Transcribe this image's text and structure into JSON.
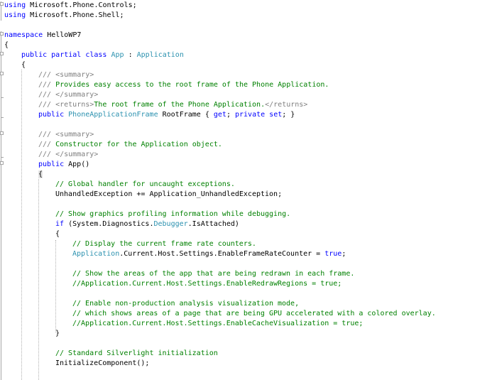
{
  "editor": {
    "lines": [
      {
        "indent": 0,
        "tokens": [
          {
            "c": "kw",
            "t": "using"
          },
          {
            "c": "",
            "t": " Microsoft.Phone.Controls;"
          }
        ]
      },
      {
        "indent": 0,
        "tokens": [
          {
            "c": "kw",
            "t": "using"
          },
          {
            "c": "",
            "t": " Microsoft.Phone.Shell;"
          }
        ]
      },
      {
        "indent": 0,
        "tokens": []
      },
      {
        "indent": 0,
        "tokens": [
          {
            "c": "kw",
            "t": "namespace"
          },
          {
            "c": "",
            "t": " HelloWP7"
          }
        ]
      },
      {
        "indent": 0,
        "tokens": [
          {
            "c": "",
            "t": "{"
          }
        ]
      },
      {
        "indent": 4,
        "tokens": [
          {
            "c": "kw",
            "t": "public"
          },
          {
            "c": "",
            "t": " "
          },
          {
            "c": "kw",
            "t": "partial"
          },
          {
            "c": "",
            "t": " "
          },
          {
            "c": "kw",
            "t": "class"
          },
          {
            "c": "",
            "t": " "
          },
          {
            "c": "ty",
            "t": "App"
          },
          {
            "c": "",
            "t": " : "
          },
          {
            "c": "ty",
            "t": "Application"
          }
        ]
      },
      {
        "indent": 4,
        "tokens": [
          {
            "c": "",
            "t": "{"
          }
        ]
      },
      {
        "indent": 8,
        "tokens": [
          {
            "c": "xd",
            "t": "///"
          },
          {
            "c": "cm",
            "t": " "
          },
          {
            "c": "xd",
            "t": "<summary>"
          }
        ]
      },
      {
        "indent": 8,
        "tokens": [
          {
            "c": "xd",
            "t": "///"
          },
          {
            "c": "cm",
            "t": " Provides easy access to the root frame of the Phone Application."
          }
        ]
      },
      {
        "indent": 8,
        "tokens": [
          {
            "c": "xd",
            "t": "///"
          },
          {
            "c": "cm",
            "t": " "
          },
          {
            "c": "xd",
            "t": "</summary>"
          }
        ]
      },
      {
        "indent": 8,
        "tokens": [
          {
            "c": "xd",
            "t": "///"
          },
          {
            "c": "cm",
            "t": " "
          },
          {
            "c": "xd",
            "t": "<returns>"
          },
          {
            "c": "cm",
            "t": "The root frame of the Phone Application."
          },
          {
            "c": "xd",
            "t": "</returns>"
          }
        ]
      },
      {
        "indent": 8,
        "tokens": [
          {
            "c": "kw",
            "t": "public"
          },
          {
            "c": "",
            "t": " "
          },
          {
            "c": "ty",
            "t": "PhoneApplicationFrame"
          },
          {
            "c": "",
            "t": " RootFrame { "
          },
          {
            "c": "kw",
            "t": "get"
          },
          {
            "c": "",
            "t": "; "
          },
          {
            "c": "kw",
            "t": "private"
          },
          {
            "c": "",
            "t": " "
          },
          {
            "c": "kw",
            "t": "set"
          },
          {
            "c": "",
            "t": "; }"
          }
        ]
      },
      {
        "indent": 0,
        "tokens": []
      },
      {
        "indent": 8,
        "tokens": [
          {
            "c": "xd",
            "t": "///"
          },
          {
            "c": "cm",
            "t": " "
          },
          {
            "c": "xd",
            "t": "<summary>"
          }
        ]
      },
      {
        "indent": 8,
        "tokens": [
          {
            "c": "xd",
            "t": "///"
          },
          {
            "c": "cm",
            "t": " Constructor for the Application object."
          }
        ]
      },
      {
        "indent": 8,
        "tokens": [
          {
            "c": "xd",
            "t": "///"
          },
          {
            "c": "cm",
            "t": " "
          },
          {
            "c": "xd",
            "t": "</summary>"
          }
        ]
      },
      {
        "indent": 8,
        "tokens": [
          {
            "c": "kw",
            "t": "public"
          },
          {
            "c": "",
            "t": " App()"
          }
        ]
      },
      {
        "indent": 8,
        "tokens": [
          {
            "c": "hl",
            "t": "{"
          }
        ]
      },
      {
        "indent": 12,
        "tokens": [
          {
            "c": "cm",
            "t": "// Global handler for uncaught exceptions."
          }
        ]
      },
      {
        "indent": 12,
        "tokens": [
          {
            "c": "",
            "t": "UnhandledException += Application_UnhandledException;"
          }
        ]
      },
      {
        "indent": 0,
        "tokens": []
      },
      {
        "indent": 12,
        "tokens": [
          {
            "c": "cm",
            "t": "// Show graphics profiling information while debugging."
          }
        ]
      },
      {
        "indent": 12,
        "tokens": [
          {
            "c": "kw",
            "t": "if"
          },
          {
            "c": "",
            "t": " (System.Diagnostics."
          },
          {
            "c": "ty",
            "t": "Debugger"
          },
          {
            "c": "",
            "t": ".IsAttached)"
          }
        ]
      },
      {
        "indent": 12,
        "tokens": [
          {
            "c": "",
            "t": "{"
          }
        ]
      },
      {
        "indent": 16,
        "tokens": [
          {
            "c": "cm",
            "t": "// Display the current frame rate counters."
          }
        ]
      },
      {
        "indent": 16,
        "tokens": [
          {
            "c": "ty",
            "t": "Application"
          },
          {
            "c": "",
            "t": ".Current.Host.Settings.EnableFrameRateCounter = "
          },
          {
            "c": "kw",
            "t": "true"
          },
          {
            "c": "",
            "t": ";"
          }
        ]
      },
      {
        "indent": 0,
        "tokens": []
      },
      {
        "indent": 16,
        "tokens": [
          {
            "c": "cm",
            "t": "// Show the areas of the app that are being redrawn in each frame."
          }
        ]
      },
      {
        "indent": 16,
        "tokens": [
          {
            "c": "cm",
            "t": "//Application.Current.Host.Settings.EnableRedrawRegions = true;"
          }
        ]
      },
      {
        "indent": 0,
        "tokens": []
      },
      {
        "indent": 16,
        "tokens": [
          {
            "c": "cm",
            "t": "// Enable non-production analysis visualization mode,"
          }
        ]
      },
      {
        "indent": 16,
        "tokens": [
          {
            "c": "cm",
            "t": "// which shows areas of a page that are being GPU accelerated with a colored overlay."
          }
        ]
      },
      {
        "indent": 16,
        "tokens": [
          {
            "c": "cm",
            "t": "//Application.Current.Host.Settings.EnableCacheVisualization = true;"
          }
        ]
      },
      {
        "indent": 12,
        "tokens": [
          {
            "c": "",
            "t": "}"
          }
        ]
      },
      {
        "indent": 0,
        "tokens": []
      },
      {
        "indent": 12,
        "tokens": [
          {
            "c": "cm",
            "t": "// Standard Silverlight initialization"
          }
        ]
      },
      {
        "indent": 12,
        "tokens": [
          {
            "c": "",
            "t": "InitializeComponent();"
          }
        ]
      }
    ]
  },
  "colors": {
    "keyword": "#0000ff",
    "type": "#2b91af",
    "comment": "#008000",
    "xmldoc": "#808080",
    "text": "#000000",
    "background": "#ffffff"
  }
}
